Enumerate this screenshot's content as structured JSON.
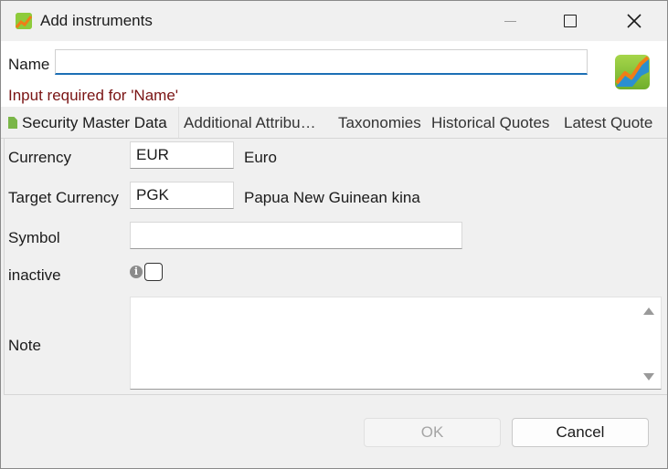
{
  "window": {
    "title": "Add instruments",
    "app_icon": "chart-app-icon"
  },
  "header": {
    "name_label": "Name",
    "name_value": "",
    "error": "Input required for 'Name'",
    "logo_icon": "portfolio-logo-icon"
  },
  "tabs": [
    {
      "label": "Security Master Data",
      "active": true
    },
    {
      "label": "Additional Attribu…",
      "active": false
    },
    {
      "label": "Taxonomies",
      "active": false
    },
    {
      "label": "Historical Quotes",
      "active": false
    },
    {
      "label": "Latest Quote",
      "active": false
    }
  ],
  "form": {
    "currency_label": "Currency",
    "currency_value": "EUR",
    "currency_desc": "Euro",
    "target_currency_label": "Target Currency",
    "target_currency_value": "PGK",
    "target_currency_desc": "Papua New Guinean kina",
    "symbol_label": "Symbol",
    "symbol_value": "",
    "inactive_label": "inactive",
    "inactive_checked": false,
    "note_label": "Note",
    "note_value": ""
  },
  "buttons": {
    "ok": "OK",
    "cancel": "Cancel"
  },
  "colors": {
    "error": "#7a1414",
    "focus": "#1c6fb5",
    "accent_green": "#8ecb3b"
  }
}
